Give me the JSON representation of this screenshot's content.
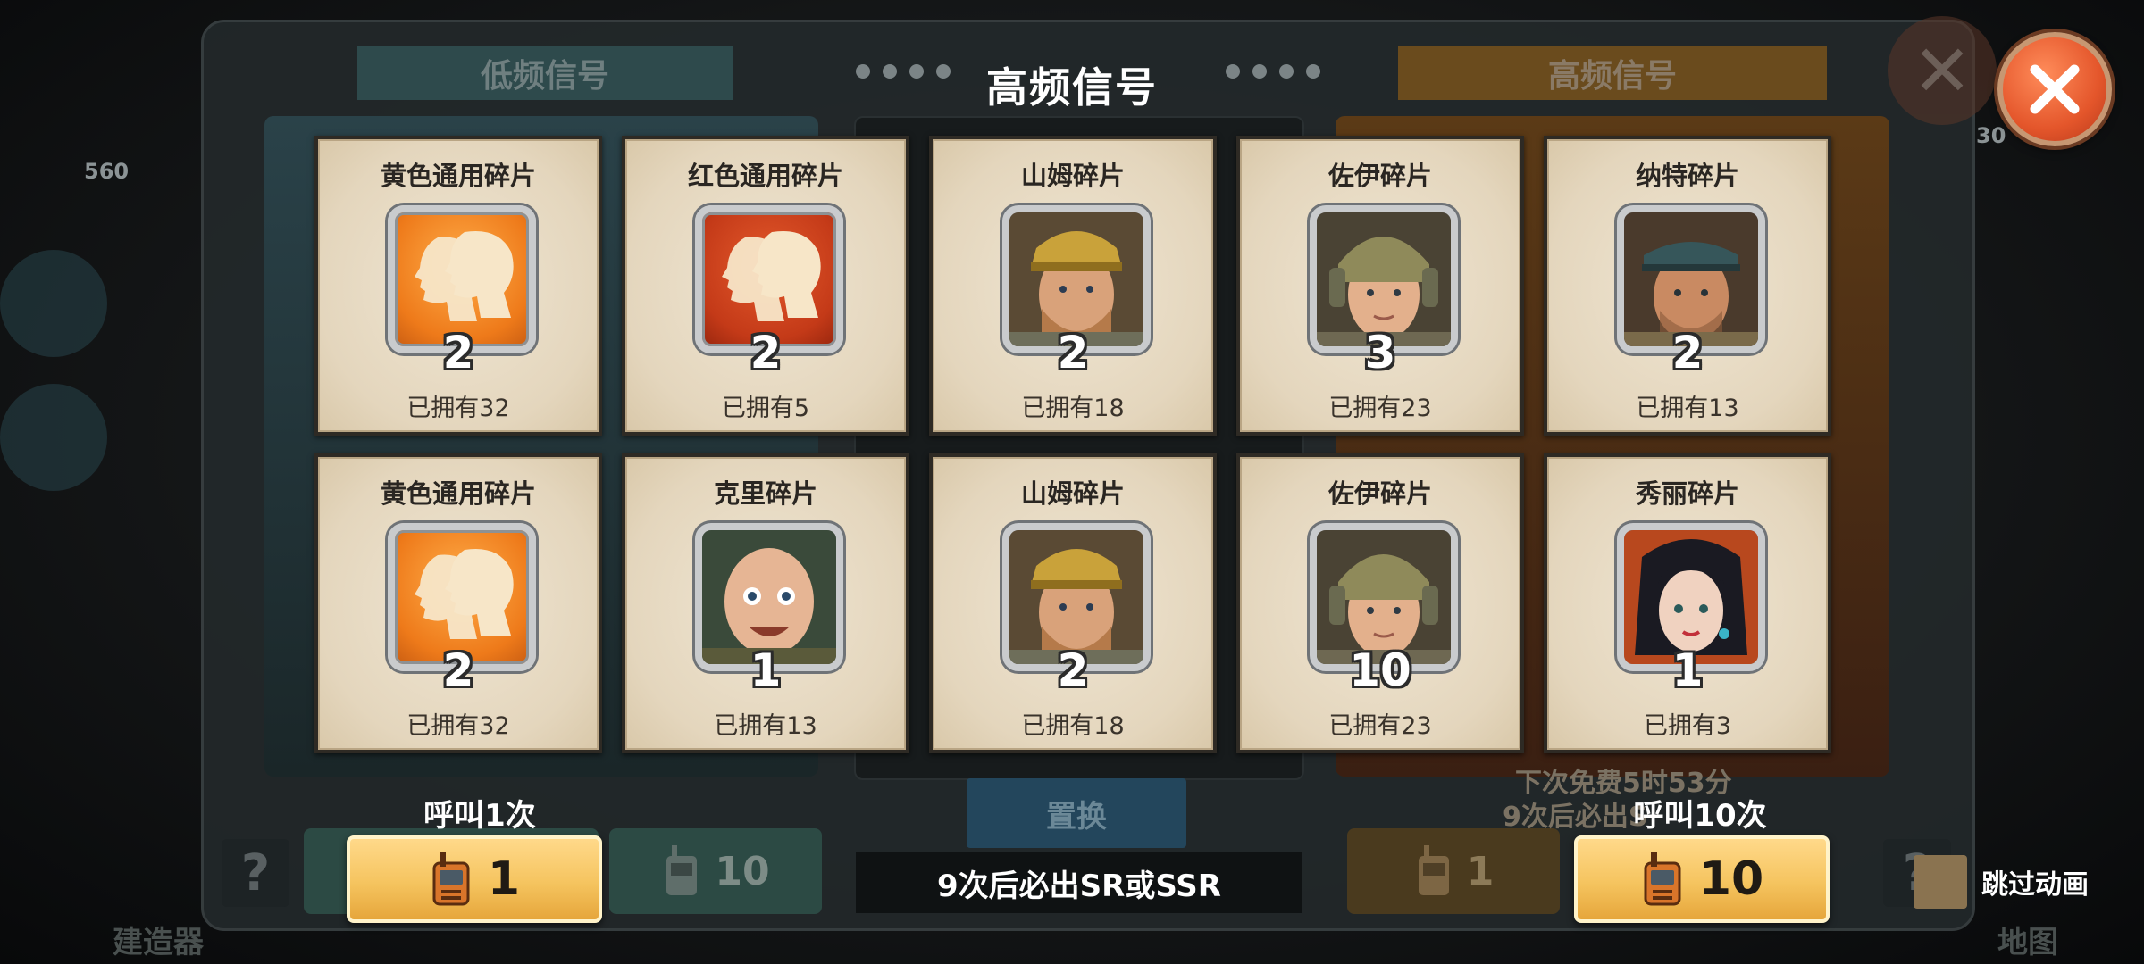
{
  "background": {
    "tab_left": "低频信号",
    "tab_right": "高频信号",
    "swap_label": "置换",
    "free_timer": "下次免费5时53分",
    "guarantee_partial": "9次后必出S",
    "dim_btn_1_count": "10",
    "dim_btn_2_count": "1",
    "bottom_left_label": "建造器",
    "bottom_right_label": "地图",
    "question_mark": "?",
    "side_count": "560",
    "right_count": "30"
  },
  "title": "高频信号",
  "cards": [
    {
      "name": "黄色通用碎片",
      "qty": "2",
      "owned": "已拥有32",
      "icon": "yellow-shard-icon"
    },
    {
      "name": "红色通用碎片",
      "qty": "2",
      "owned": "已拥有5",
      "icon": "red-shard-icon"
    },
    {
      "name": "山姆碎片",
      "qty": "2",
      "owned": "已拥有18",
      "icon": "sam-portrait-icon"
    },
    {
      "name": "佐伊碎片",
      "qty": "3",
      "owned": "已拥有23",
      "icon": "zoey-portrait-icon"
    },
    {
      "name": "纳特碎片",
      "qty": "2",
      "owned": "已拥有13",
      "icon": "nate-portrait-icon"
    },
    {
      "name": "黄色通用碎片",
      "qty": "2",
      "owned": "已拥有32",
      "icon": "yellow-shard-icon"
    },
    {
      "name": "克里碎片",
      "qty": "1",
      "owned": "已拥有13",
      "icon": "kerry-portrait-icon"
    },
    {
      "name": "山姆碎片",
      "qty": "2",
      "owned": "已拥有18",
      "icon": "sam-portrait-icon"
    },
    {
      "name": "佐伊碎片",
      "qty": "10",
      "owned": "已拥有23",
      "icon": "zoey-portrait-icon"
    },
    {
      "name": "秀丽碎片",
      "qty": "1",
      "owned": "已拥有3",
      "icon": "xiuli-portrait-icon"
    }
  ],
  "call_once": {
    "label": "呼叫1次",
    "count": "1",
    "icon": "walkie-talkie-icon"
  },
  "call_ten": {
    "label": "呼叫10次",
    "count": "10",
    "icon": "walkie-talkie-icon"
  },
  "guarantee": "9次后必出SR或SSR",
  "skip_animation": "跳过动画",
  "colors": {
    "accent_gold": "#f5c45f",
    "close_orange": "#e4562b",
    "card_paper": "#e8dcc6"
  }
}
